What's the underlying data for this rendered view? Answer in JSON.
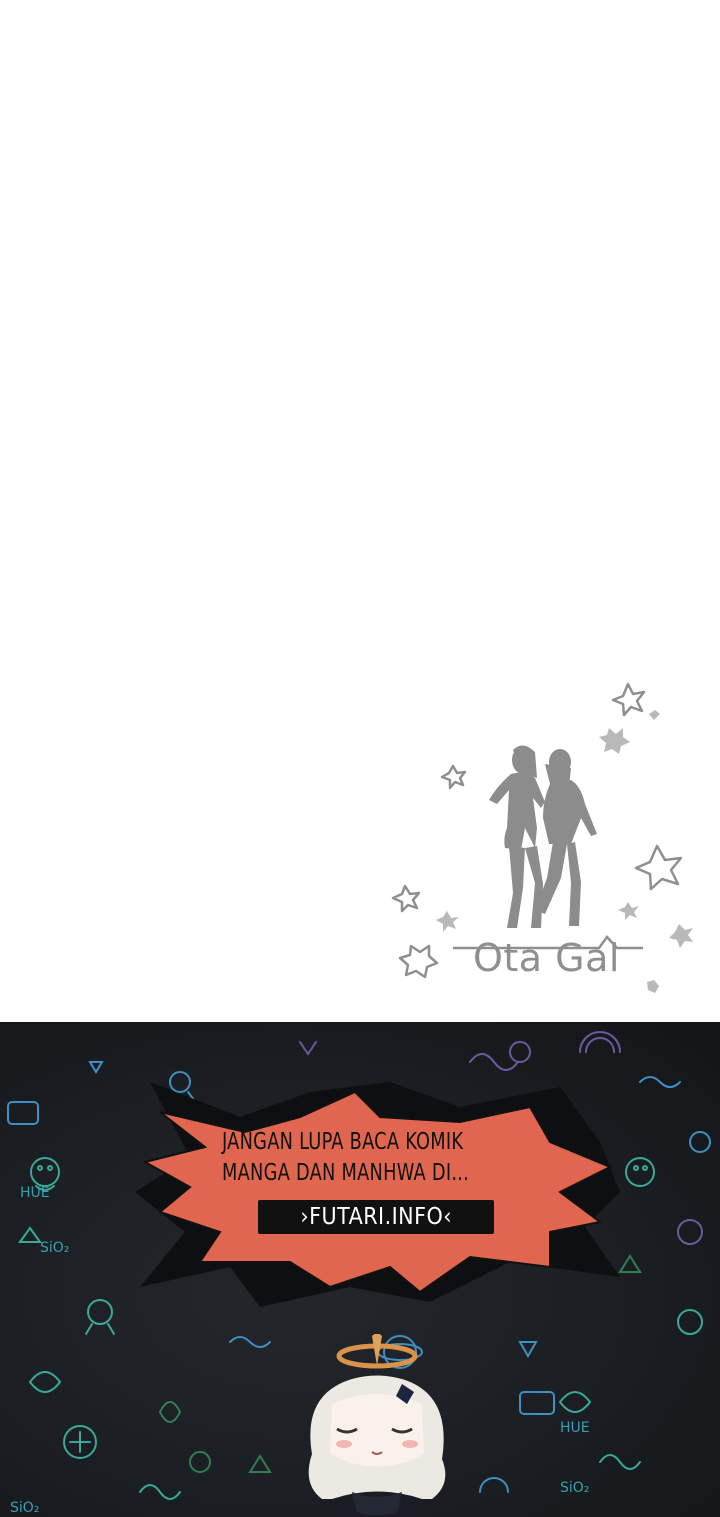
{
  "credit": {
    "logo_text": "Ota Gal",
    "logo_color": "#8f8f8f",
    "logo_icon": "two-girls-silhouette-with-stars"
  },
  "promo": {
    "line1": "JANGAN LUPA BACA KOMIK",
    "line2": "MANGA DAN MANHWA DI...",
    "url": "›FUTARI.INFO‹",
    "banner_color": "#e06650",
    "background_color": "#1c1f23",
    "mascot": "chibi-girl-with-halo-icon"
  }
}
